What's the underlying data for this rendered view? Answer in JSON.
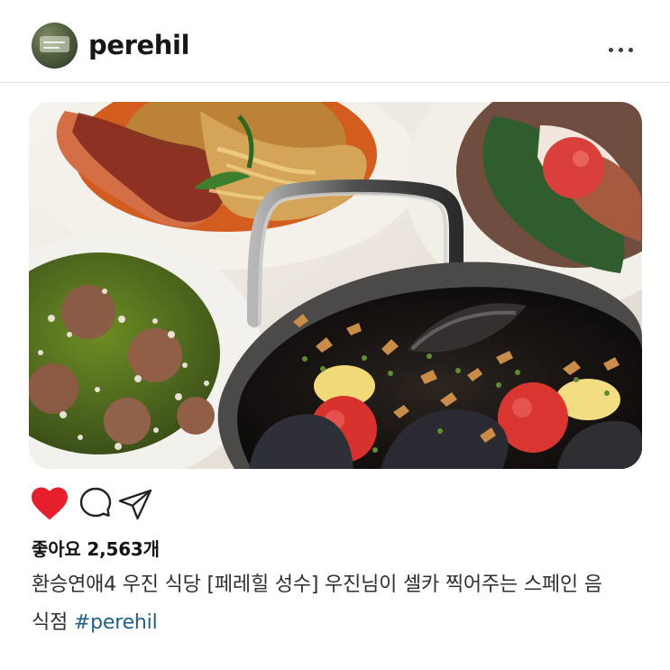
{
  "header": {
    "username": "perehil"
  },
  "icons": {
    "avatar": "profile-avatar",
    "more": "more-horizontal-icon",
    "like": "heart-filled-icon",
    "comment": "comment-bubble-icon",
    "share": "send-plane-icon"
  },
  "post": {
    "likes_text": "좋아요 2,563개",
    "caption_line_1": "환승연애4 우진 식당 [페레힐 성수] 우진님이 셀카 찍어주는 스페인 음",
    "caption_line_2_text": "식점",
    "hashtag": "#perehil"
  },
  "colors": {
    "like": "#e5202c",
    "hashtag": "#1f5f88",
    "divider": "#dfdfdf"
  }
}
